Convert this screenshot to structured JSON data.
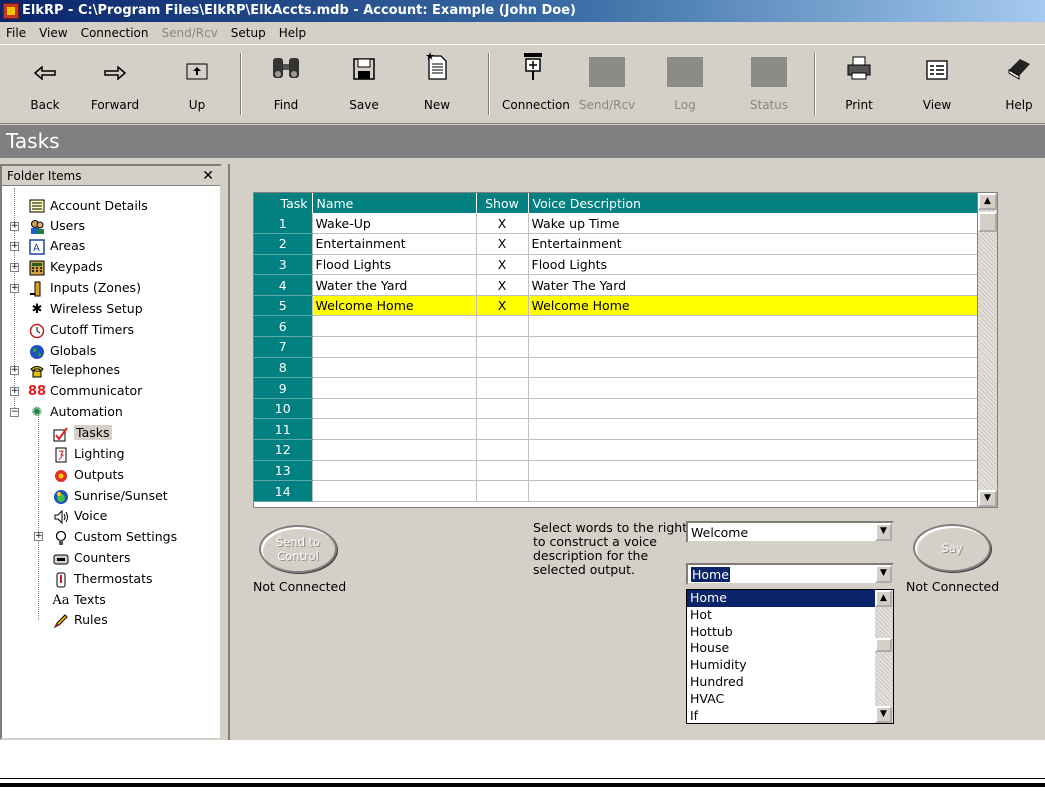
{
  "window": {
    "title": "ElkRP - C:\\Program Files\\ElkRP\\ElkAccts.mdb - Account: Example (John Doe)"
  },
  "menu": [
    {
      "label": "File",
      "enabled": true
    },
    {
      "label": "View",
      "enabled": true
    },
    {
      "label": "Connection",
      "enabled": true
    },
    {
      "label": "Send/Rcv",
      "enabled": false
    },
    {
      "label": "Setup",
      "enabled": true
    },
    {
      "label": "Help",
      "enabled": true
    }
  ],
  "toolbar": {
    "back": "Back",
    "forward": "Forward",
    "up": "Up",
    "find": "Find",
    "save": "Save",
    "new": "New",
    "connection": "Connection",
    "sendrcv": "Send/Rcv",
    "log": "Log",
    "status": "Status",
    "print": "Print",
    "view": "View",
    "help": "Help"
  },
  "view_title": "Tasks",
  "folder_pane": {
    "header": "Folder Items",
    "close": "✕",
    "items": [
      {
        "label": "Account Details",
        "icon": "document-icon"
      },
      {
        "label": "Users",
        "icon": "users-icon"
      },
      {
        "label": "Areas",
        "icon": "areas-icon"
      },
      {
        "label": "Keypads",
        "icon": "keypad-icon"
      },
      {
        "label": "Inputs (Zones)",
        "icon": "inputs-icon"
      },
      {
        "label": "Wireless Setup",
        "icon": "wireless-icon"
      },
      {
        "label": "Cutoff Timers",
        "icon": "timer-icon"
      },
      {
        "label": "Globals",
        "icon": "globe-icon"
      },
      {
        "label": "Telephones",
        "icon": "telephone-icon"
      },
      {
        "label": "Communicator",
        "icon": "communicator-icon"
      },
      {
        "label": "Automation",
        "icon": "automation-icon"
      },
      {
        "label": "Tasks",
        "icon": "tasks-checkbox-icon",
        "selected": true
      },
      {
        "label": "Lighting",
        "icon": "lighting-icon"
      },
      {
        "label": "Outputs",
        "icon": "outputs-icon"
      },
      {
        "label": "Sunrise/Sunset",
        "icon": "sunrise-icon"
      },
      {
        "label": "Voice",
        "icon": "speaker-icon"
      },
      {
        "label": "Custom Settings",
        "icon": "custom-settings-icon"
      },
      {
        "label": "Counters",
        "icon": "counter-icon"
      },
      {
        "label": "Thermostats",
        "icon": "thermostat-icon"
      },
      {
        "label": "Texts",
        "icon": "text-icon"
      },
      {
        "label": "Rules",
        "icon": "pencil-icon"
      }
    ]
  },
  "grid": {
    "columns": [
      "Task",
      "Name",
      "Show",
      "Voice Description"
    ],
    "rows": [
      {
        "task": "1",
        "name": "Wake-Up",
        "show": "X",
        "voice": "Wake up Time"
      },
      {
        "task": "2",
        "name": "Entertainment",
        "show": "X",
        "voice": "Entertainment"
      },
      {
        "task": "3",
        "name": "Flood Lights",
        "show": "X",
        "voice": "Flood Lights"
      },
      {
        "task": "4",
        "name": "Water the Yard",
        "show": "X",
        "voice": "Water The Yard"
      },
      {
        "task": "5",
        "name": "Welcome Home",
        "show": "X",
        "voice": "Welcome Home",
        "highlighted": true
      },
      {
        "task": "6",
        "name": "",
        "show": "",
        "voice": ""
      },
      {
        "task": "7",
        "name": "",
        "show": "",
        "voice": ""
      },
      {
        "task": "8",
        "name": "",
        "show": "",
        "voice": ""
      },
      {
        "task": "9",
        "name": "",
        "show": "",
        "voice": ""
      },
      {
        "task": "10",
        "name": "",
        "show": "",
        "voice": ""
      },
      {
        "task": "11",
        "name": "",
        "show": "",
        "voice": ""
      },
      {
        "task": "12",
        "name": "",
        "show": "",
        "voice": ""
      },
      {
        "task": "13",
        "name": "",
        "show": "",
        "voice": ""
      },
      {
        "task": "14",
        "name": "",
        "show": "",
        "voice": ""
      }
    ]
  },
  "send_to_control": {
    "label_line1": "Send to",
    "label_line2": "Control",
    "status": "Not Connected"
  },
  "voice_builder": {
    "instructions": "Select words to the right to construct a voice description for the selected output.",
    "word1_value": "Welcome",
    "word2_value": "Home",
    "word_list": [
      "Home",
      "Hot",
      "Hottub",
      "House",
      "Humidity",
      "Hundred",
      "HVAC",
      "If"
    ],
    "say_label": "Say",
    "say_status": "Not Connected"
  },
  "scroll_arrows": {
    "up": "▲",
    "down": "▼"
  },
  "colors": {
    "teal": "#008080",
    "highlight": "#ffff00",
    "selection": "#0a246a",
    "face": "#d4d0c8"
  }
}
